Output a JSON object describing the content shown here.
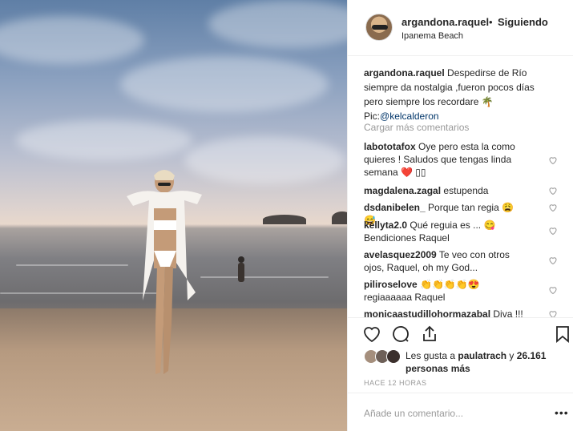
{
  "post": {
    "username": "argandona.raquel",
    "separator": "•",
    "follow_status": "Siguiendo",
    "location": "Ipanema Beach"
  },
  "caption": {
    "username": "argandona.raquel",
    "text": "Despedirse de Río siempre da nostalgia ,fueron pocos días pero siempre los recordare 🌴",
    "pic_label": "Pic:",
    "mention": "@kelcalderon"
  },
  "load_more": "Cargar más comentarios",
  "comments": [
    {
      "user": "labototafox",
      "text": "Oye pero esta la como quieres ! Saludos que tengas linda semana ❤️ ▯▯"
    },
    {
      "user": "magdalena.zagal",
      "text": "estupenda"
    },
    {
      "user": "dsdanibelen_",
      "text": "Porque tan regia 😩 😅"
    },
    {
      "user": "kellyta2.0",
      "text": "Qué reguia es ... 😋 Bendiciones Raquel"
    },
    {
      "user": "avelasquez2009",
      "text": "Te veo con otros ojos, Raquel, oh my God..."
    },
    {
      "user": "piliroselove",
      "text": "👏👏👏👏😍 regiaaaaaa Raquel"
    },
    {
      "user": "monicaastudillohormazabal",
      "text": "Diva !!!"
    }
  ],
  "likes": {
    "prefix": "Les gusta a",
    "user": "paulatrach",
    "conj": "y",
    "count": "26.161 personas más"
  },
  "timestamp": "HACE 12 HORAS",
  "add_comment_placeholder": "Añade un comentario...",
  "more_options": "•••",
  "icons": [
    "heart-icon",
    "comment-icon",
    "share-icon",
    "bookmark-icon"
  ]
}
